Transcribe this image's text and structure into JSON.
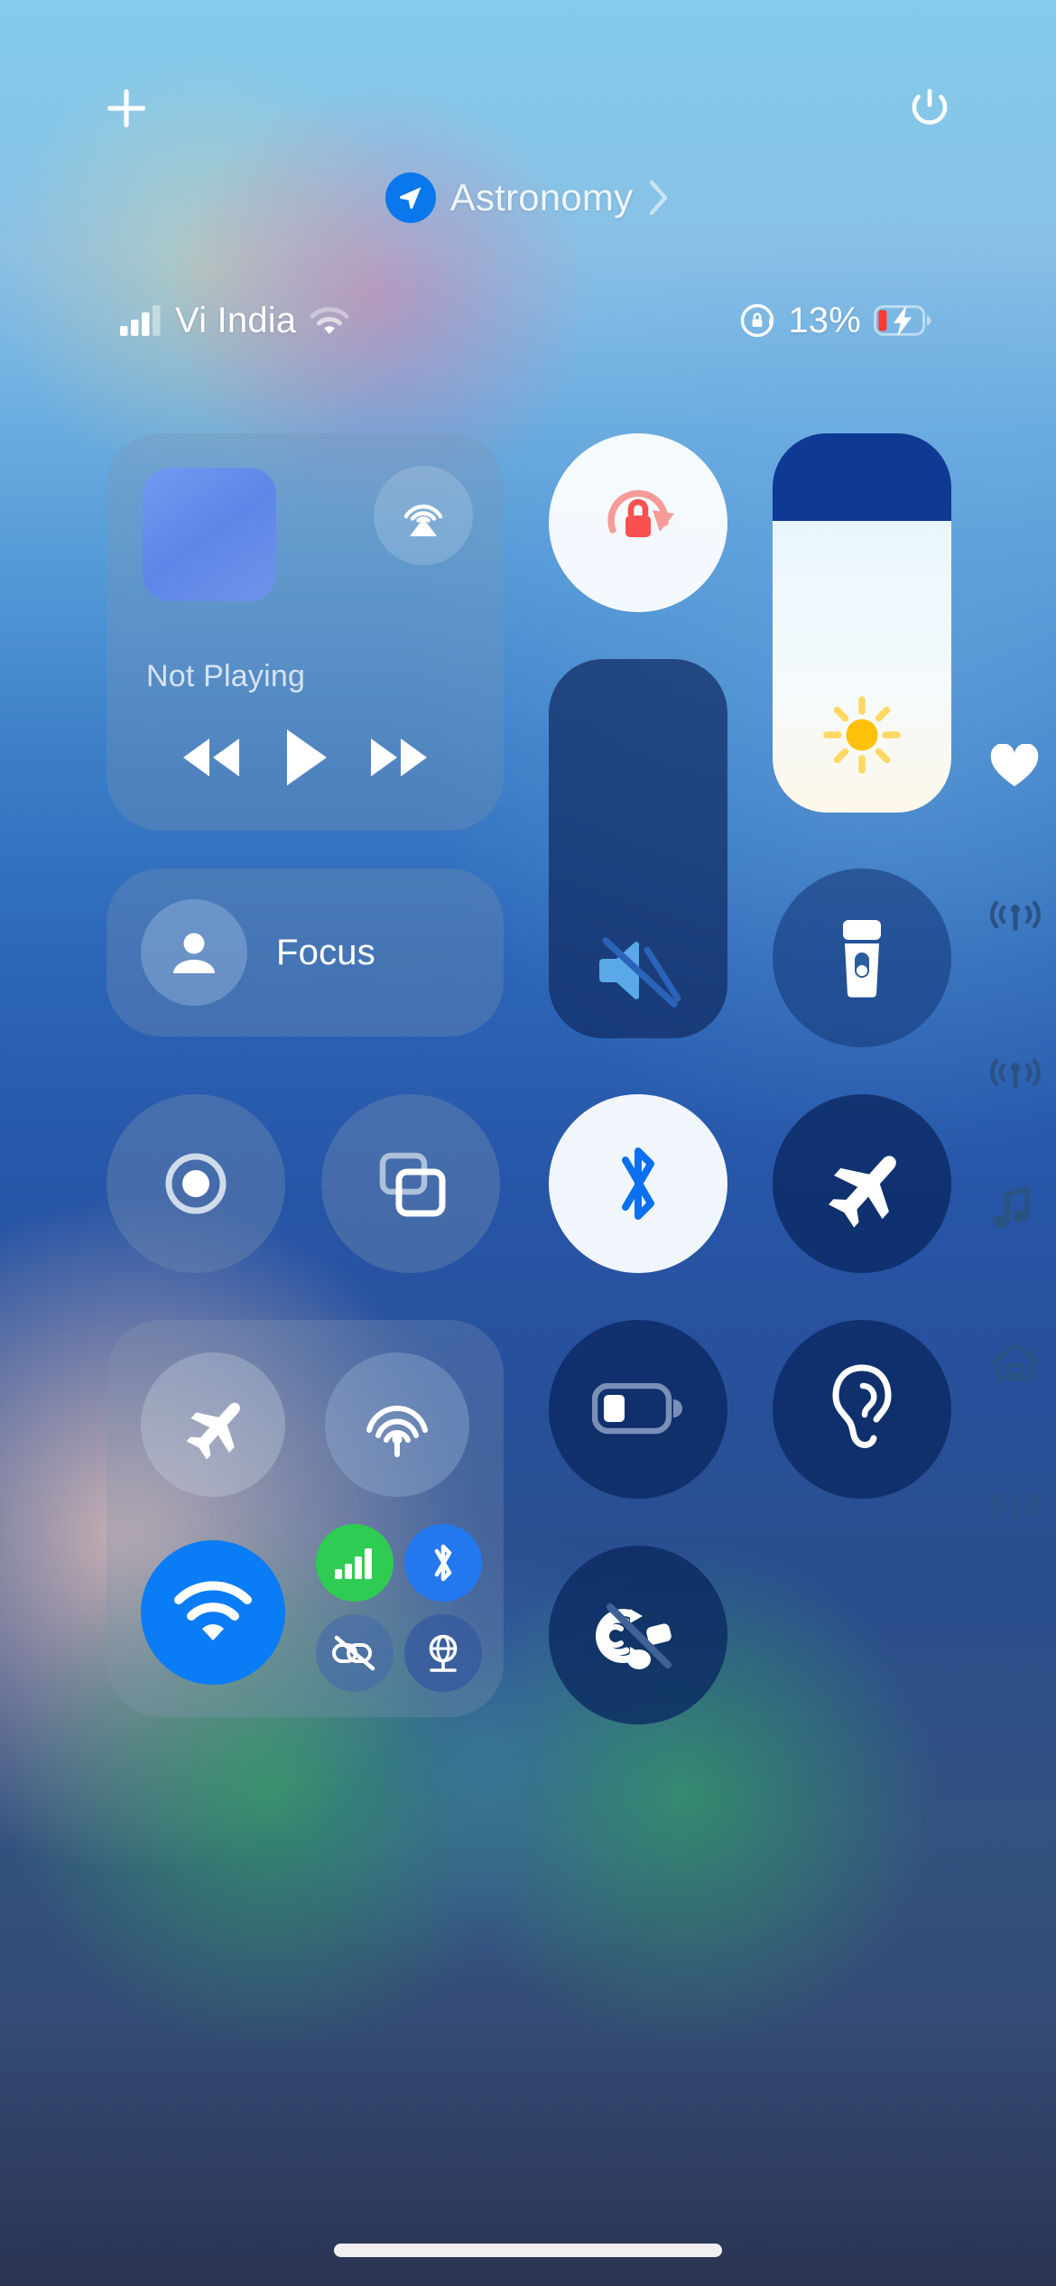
{
  "wallpaper": {
    "top_color": "#8ad2f2",
    "bottom_color": "#303a57",
    "accent_pink": "#f0789f",
    "accent_green": "#3cb46e"
  },
  "topbar": {
    "add_label": "+",
    "add_icon": "plus-icon",
    "power_icon": "power-icon"
  },
  "mode_pill": {
    "icon": "location-arrow-icon",
    "icon_color": "#0a77ec",
    "label": "Astronomy",
    "chevron": "chevron-right-icon"
  },
  "statusbar": {
    "signal_icon": "cellular-bars-icon",
    "signal_bars": 3,
    "signal_total_bars": 4,
    "carrier": "Vi India",
    "wifi_icon": "wifi-icon",
    "rotation_lock_icon": "rotation-lock-icon",
    "battery_percent": "13%",
    "battery_level": 13,
    "battery_icon": "battery-charging-icon",
    "battery_fill_color": "#ff3b30",
    "charging": true
  },
  "media": {
    "album_art": "album-art-placeholder",
    "airplay_icon": "airplay-icon",
    "title": "Not Playing",
    "rewind_icon": "rewind-icon",
    "play_icon": "play-icon",
    "forward_icon": "fast-forward-icon"
  },
  "focus": {
    "icon": "person-icon",
    "label": "Focus"
  },
  "sliders": {
    "rotation_lock": {
      "icon": "rotation-lock-icon",
      "label": "Rotation Lock",
      "state": "on",
      "icon_color": "#f8514f"
    },
    "volume": {
      "icon": "speaker-mute-icon",
      "label": "Volume",
      "value": 0,
      "state": "muted"
    },
    "brightness": {
      "icon": "sun-icon",
      "label": "Brightness",
      "value": 77,
      "icon_color": "#ffc409"
    }
  },
  "toggles": [
    {
      "name": "flashlight",
      "icon": "flashlight-icon",
      "label": "Flashlight",
      "state": "off"
    },
    {
      "name": "screen-record",
      "icon": "screen-record-icon",
      "label": "Screen Recording",
      "state": "off"
    },
    {
      "name": "screen-mirror",
      "icon": "screen-mirroring-icon",
      "label": "Screen Mirroring",
      "state": "off"
    },
    {
      "name": "bluetooth",
      "icon": "bluetooth-icon",
      "label": "Bluetooth",
      "state": "on"
    },
    {
      "name": "airplane",
      "icon": "airplane-icon",
      "label": "Airplane Mode",
      "state": "off"
    },
    {
      "name": "low-power",
      "icon": "low-battery-icon",
      "label": "Low Power Mode",
      "state": "off"
    },
    {
      "name": "hearing",
      "icon": "ear-icon",
      "label": "Hearing",
      "state": "off"
    },
    {
      "name": "announce",
      "icon": "announce-notifications-off-icon",
      "label": "Announce Notifications",
      "state": "off"
    }
  ],
  "connectivity": {
    "airplane": {
      "icon": "airplane-icon",
      "label": "Airplane Mode",
      "state": "off"
    },
    "airdrop": {
      "icon": "airdrop-icon",
      "label": "AirDrop",
      "state": "off"
    },
    "wifi": {
      "icon": "wifi-icon",
      "label": "Wi-Fi",
      "state": "on",
      "color": "#0a7cf5"
    },
    "cellular": {
      "icon": "cellular-bars-icon",
      "label": "Cellular Data",
      "state": "on",
      "color": "#2ecc52"
    },
    "bluetooth": {
      "icon": "bluetooth-icon",
      "label": "Bluetooth",
      "state": "on",
      "color": "#2378f0"
    },
    "hotspot": {
      "icon": "personal-hotspot-off-icon",
      "label": "Personal Hotspot",
      "state": "off"
    },
    "vpn": {
      "icon": "vpn-globe-icon",
      "label": "VPN",
      "state": "off"
    }
  },
  "edge_icons": [
    {
      "name": "health",
      "icon": "heart-icon",
      "label": "Health"
    },
    {
      "name": "cast1",
      "icon": "broadcast-icon",
      "label": "Broadcast"
    },
    {
      "name": "cast2",
      "icon": "broadcast-icon",
      "label": "Broadcast"
    },
    {
      "name": "music",
      "icon": "music-note-icon",
      "label": "Music"
    },
    {
      "name": "home",
      "icon": "home-icon",
      "label": "Home"
    },
    {
      "name": "cast3",
      "icon": "broadcast-icon",
      "label": "Broadcast"
    }
  ],
  "home_indicator": {
    "label": "Home Indicator"
  }
}
